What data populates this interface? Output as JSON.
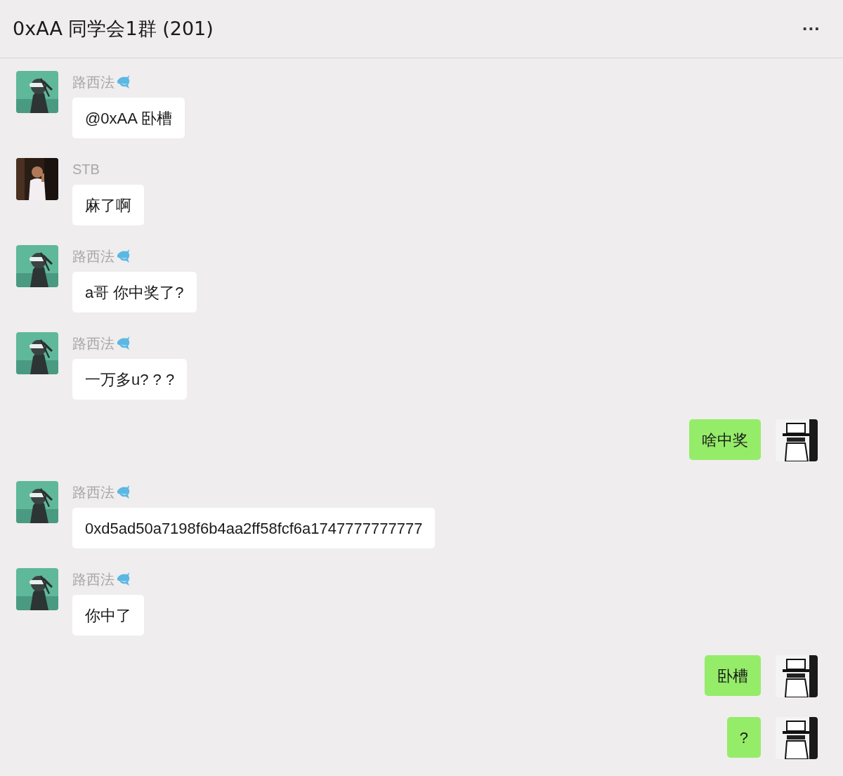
{
  "window": {
    "title": "0xAA 同学会1群 (201)",
    "menu": "···"
  },
  "messages": [
    {
      "kind": "incoming",
      "sender": "路西法",
      "sender_icon": true,
      "text": "@0xAA 卧槽"
    },
    {
      "kind": "incoming",
      "sender": "STB",
      "sender_icon": false,
      "text": "麻了啊"
    },
    {
      "kind": "incoming",
      "sender": "路西法",
      "sender_icon": true,
      "text": "a哥 你中奖了?"
    },
    {
      "kind": "incoming",
      "sender": "路西法",
      "sender_icon": true,
      "text": "一万多u? ? ?"
    },
    {
      "kind": "outgoing",
      "text": "啥中奖"
    },
    {
      "kind": "incoming",
      "sender": "路西法",
      "sender_icon": true,
      "text": "0xd5ad50a7198f6b4aa2ff58fcf6a1747777777777"
    },
    {
      "kind": "incoming",
      "sender": "路西法",
      "sender_icon": true,
      "text": "你中了"
    },
    {
      "kind": "outgoing",
      "text": "卧槽"
    },
    {
      "kind": "outgoing",
      "text": "?"
    }
  ]
}
